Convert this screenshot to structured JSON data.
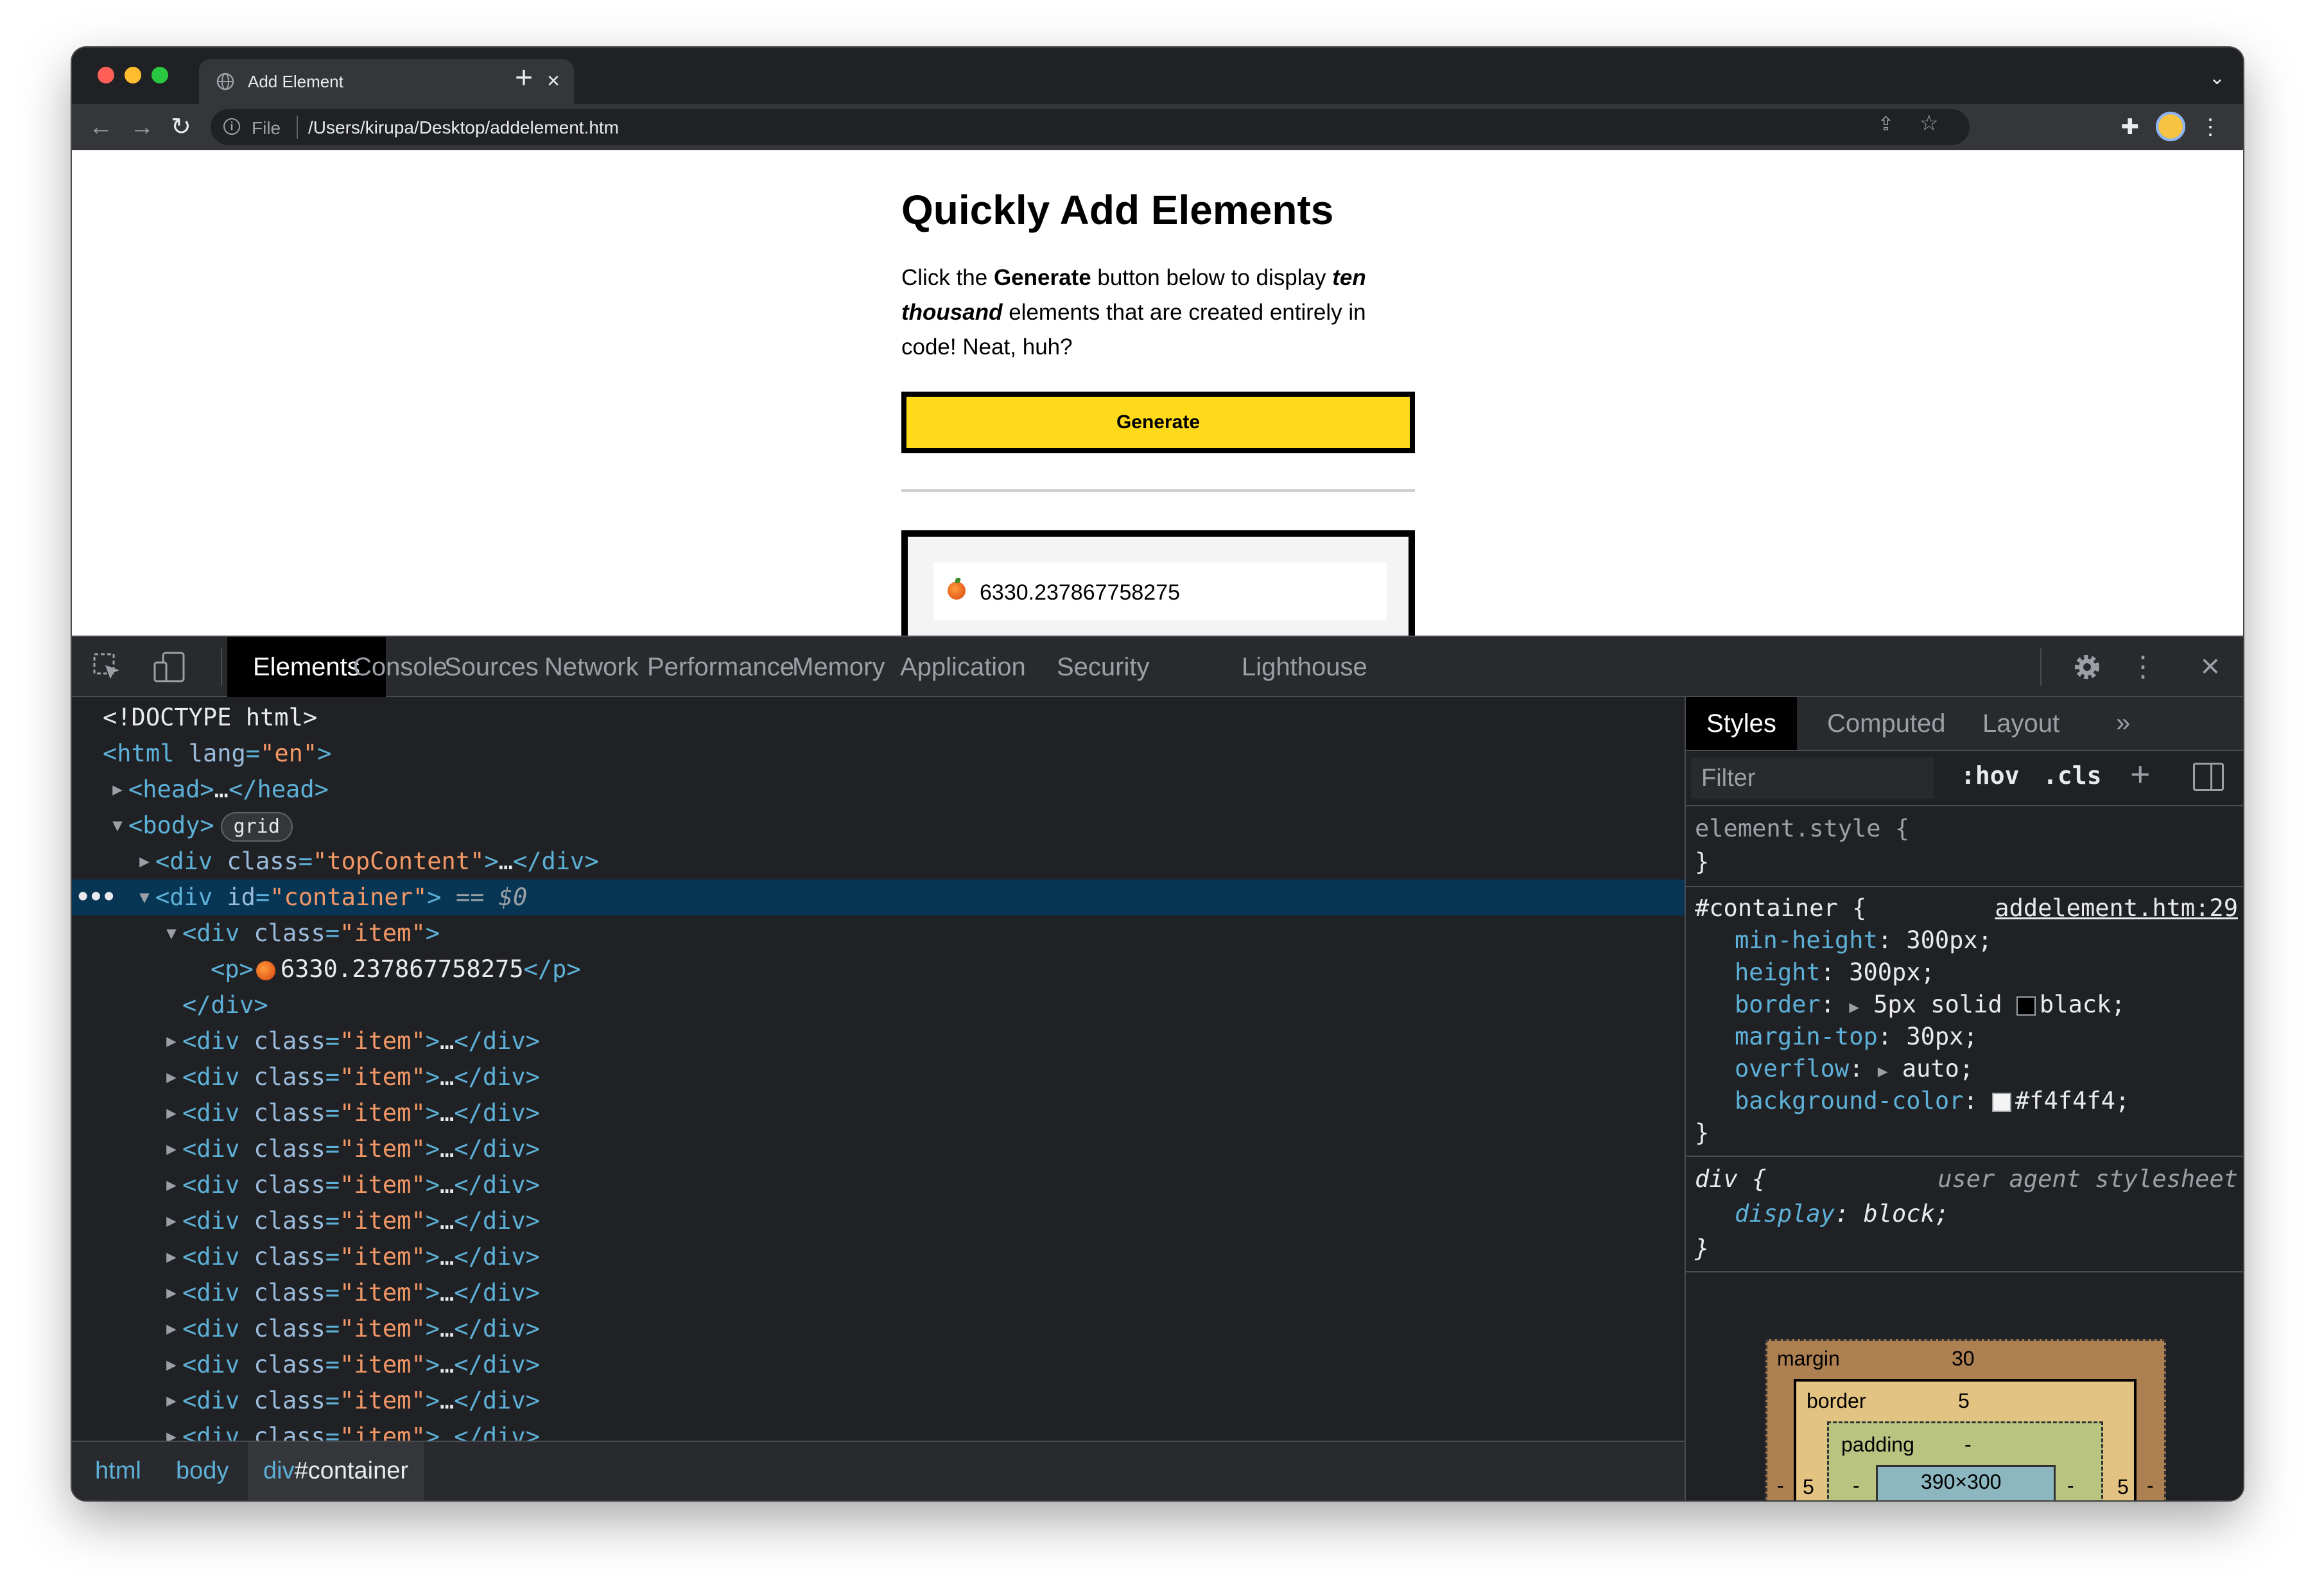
{
  "browser": {
    "tab_title": "Add Element",
    "new_tab_label": "+",
    "url_scheme": "File",
    "url_path": "/Users/kirupa/Desktop/addelement.htm"
  },
  "page": {
    "title": "Quickly Add Elements",
    "para_1": "Click the ",
    "para_bold": "Generate",
    "para_2": " button below to display ",
    "para_emph": "ten thousand",
    "para_3": " elements that are created entirely in code! Neat, huh?",
    "generate_label": "Generate",
    "item_value": "6330.237867758275"
  },
  "devtools": {
    "tabs": [
      "Elements",
      "Console",
      "Sources",
      "Network",
      "Performance",
      "Memory",
      "Application",
      "Security",
      "Lighthouse"
    ],
    "dom": {
      "doctype": "<!DOCTYPE html>",
      "html_open": "<html",
      "lang_attr": "lang",
      "lang_val": "\"en\"",
      "head_open": "<head>",
      "head_close": "</head>",
      "body_open": "<body>",
      "grid_badge": "grid",
      "topcontent_class": "\"topContent\"",
      "container_id": "\"container\"",
      "selected_marker": "== $0",
      "item_class": "\"item\"",
      "p_open": "<p>",
      "p_text": "6330.237867758275",
      "p_close": "</p>",
      "div_close": "</div>",
      "ellipsis": "…",
      "div_tag": "<div",
      "class_attr": "class",
      "id_attr": "id",
      "collapsed_rows": 12
    },
    "breadcrumbs": [
      "html",
      "body",
      "div",
      "#container"
    ],
    "styles": {
      "tabs": [
        "Styles",
        "Computed",
        "Layout"
      ],
      "more": "»",
      "filter_placeholder": "Filter",
      "hov": ":hov",
      "cls": ".cls",
      "add": "+",
      "element_style": "element.style {",
      "close_brace": "}",
      "container_selector": "#container {",
      "container_source": "addelement.htm:29",
      "props": [
        {
          "name": "min-height",
          "value": "300px;"
        },
        {
          "name": "height",
          "value": "300px;"
        },
        {
          "name": "border",
          "value": "5px solid ",
          "swatch": "#000000",
          "tail": "black;"
        },
        {
          "name": "margin-top",
          "value": "30px;"
        },
        {
          "name": "overflow",
          "value": "auto;"
        },
        {
          "name": "background-color",
          "value": "",
          "swatch": "#f4f4f4",
          "tail": "#f4f4f4;"
        }
      ],
      "div_selector": "div {",
      "div_source": "user agent stylesheet",
      "div_prop_name": "display",
      "div_prop_value": "block;",
      "box_model": {
        "margin_label": "margin",
        "margin_value": "30",
        "border_label": "border",
        "border_value": "5",
        "padding_label": "padding",
        "padding_value": "-",
        "side_value": "5",
        "side_dash": "-",
        "content_size": "390×300"
      }
    }
  }
}
